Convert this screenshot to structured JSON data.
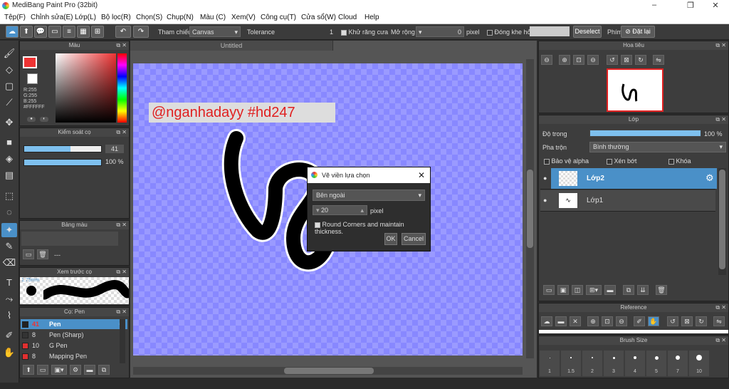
{
  "window": {
    "title": "MediBang Paint Pro (32bit)",
    "min": "–",
    "restore": "❐",
    "close": "✕"
  },
  "menu": [
    "Tệp(F)",
    "Chỉnh sửa(E)",
    "Lớp(L)",
    "Bộ lọc(R)",
    "Chọn(S)",
    "Chụp(N)",
    "Màu (C)",
    "Xem(V)",
    "Công cụ(T)",
    "Cửa sổ(W)",
    "Cloud",
    "Help"
  ],
  "toolbar": {
    "ref_label": "Tham chiếu",
    "ref_value": "Canvas",
    "tolerance_label": "Tolerance",
    "tolerance_value": "1",
    "antialias_label": "Khử răng cưa",
    "expand_label": "Mở rộng",
    "expand_value": "0",
    "expand_unit": "pixel",
    "close_gap_label": "Đóng khe hở",
    "deselect": "Deselect",
    "key_label": "Phím",
    "reset_label": "Đặt lại"
  },
  "color_panel": {
    "title": "Màu",
    "r": "R:255",
    "g": "G:255",
    "b": "B:255",
    "hex": "#FFFFFF"
  },
  "brush_control": {
    "title": "Kiểm soát cọ",
    "size": "41",
    "opacity": "100 %",
    "size_fraction": 0.6,
    "opacity_fraction": 1.0
  },
  "palette": {
    "title": "Bảng màu",
    "text": "---"
  },
  "preview": {
    "title": "Xem trước cọ",
    "size": "1.75mm"
  },
  "brush_list": {
    "title": "Cọ: Pen",
    "items": [
      {
        "n": "41",
        "name": "Pen",
        "color": "#222222",
        "active": true
      },
      {
        "n": "8",
        "name": "Pen (Sharp)",
        "color": "#333333",
        "active": false
      },
      {
        "n": "10",
        "name": "G Pen",
        "color": "#e03030",
        "active": false
      },
      {
        "n": "8",
        "name": "Mapping Pen",
        "color": "#e03030",
        "active": false
      }
    ]
  },
  "canvas": {
    "tab": "Untitled",
    "watermark": "@nganhadayy #hd247"
  },
  "dialog": {
    "title": "Vẽ viền lựa chọn",
    "mode": "Bên ngoài",
    "width": "20",
    "unit": "pixel",
    "round_label": "Round Corners and maintain thickness.",
    "ok": "OK",
    "cancel": "Cancel"
  },
  "navigator": {
    "title": "Hoa tiêu"
  },
  "layer_panel": {
    "title": "Lớp",
    "opacity_label": "Độ trong",
    "opacity_value": "100 %",
    "blend_label": "Pha trộn",
    "blend_value": "Bình thường",
    "protect_alpha": "Bảo vệ alpha",
    "clipping": "Xén bớt",
    "lock": "Khóa",
    "layers": [
      {
        "name": "Lớp2",
        "active": true
      },
      {
        "name": "Lớp1",
        "active": false
      }
    ]
  },
  "reference": {
    "title": "Reference"
  },
  "brush_size": {
    "title": "Brush Size",
    "sizes": [
      "1",
      "1.5",
      "2",
      "3",
      "4",
      "5",
      "7",
      "10"
    ]
  },
  "colors": {
    "accent": "#4a90c8",
    "canvas": "#8888ff",
    "watermark": "#e02020"
  }
}
